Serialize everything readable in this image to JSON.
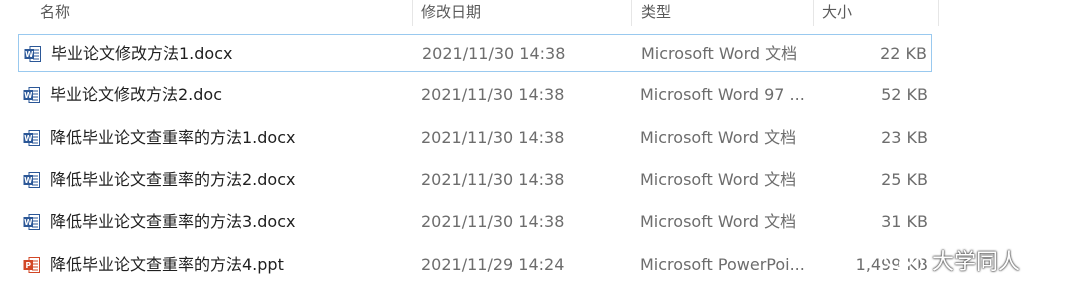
{
  "columns": {
    "name": "名称",
    "date": "修改日期",
    "type": "类型",
    "size": "大小"
  },
  "files": [
    {
      "name": "毕业论文修改方法1.docx",
      "date": "2021/11/30 14:38",
      "type": "Microsoft Word 文档",
      "size": "22 KB",
      "icon": "word-doc-icon",
      "selected": true
    },
    {
      "name": "毕业论文修改方法2.doc",
      "date": "2021/11/30 14:38",
      "type": "Microsoft Word 97 ...",
      "size": "52 KB",
      "icon": "word-97-doc-icon",
      "selected": false
    },
    {
      "name": "降低毕业论文查重率的方法1.docx",
      "date": "2021/11/30 14:38",
      "type": "Microsoft Word 文档",
      "size": "23 KB",
      "icon": "word-doc-icon",
      "selected": false
    },
    {
      "name": "降低毕业论文查重率的方法2.docx",
      "date": "2021/11/30 14:38",
      "type": "Microsoft Word 文档",
      "size": "25 KB",
      "icon": "word-doc-icon",
      "selected": false
    },
    {
      "name": "降低毕业论文查重率的方法3.docx",
      "date": "2021/11/30 14:38",
      "type": "Microsoft Word 文档",
      "size": "31 KB",
      "icon": "word-doc-icon",
      "selected": false
    },
    {
      "name": "降低毕业论文查重率的方法4.ppt",
      "date": "2021/11/29 14:24",
      "type": "Microsoft PowerPoi...",
      "size": "1,499 KB",
      "icon": "powerpoint-doc-icon",
      "selected": false
    }
  ],
  "watermark": {
    "text": "大学同人",
    "icon": "wechat-icon"
  },
  "colors": {
    "word": "#2b5797",
    "powerpoint": "#d24726",
    "selection_border": "#99c9ef"
  }
}
